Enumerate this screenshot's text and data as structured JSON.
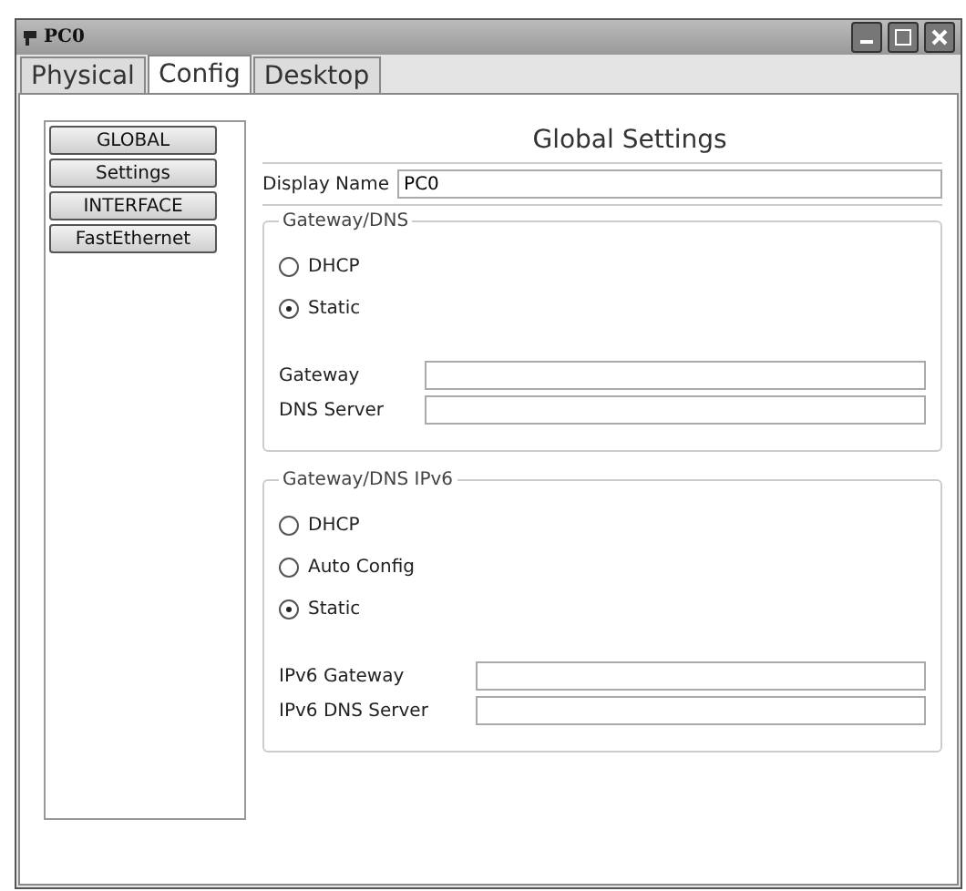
{
  "window": {
    "title": "PC0"
  },
  "tabs": [
    {
      "label": "Physical",
      "selected": false
    },
    {
      "label": "Config",
      "selected": true
    },
    {
      "label": "Desktop",
      "selected": false
    }
  ],
  "sidebar": {
    "items": [
      "GLOBAL",
      "Settings",
      "INTERFACE",
      "FastEthernet"
    ]
  },
  "panel": {
    "title": "Global Settings",
    "display_name": {
      "label": "Display Name",
      "value": "PC0"
    },
    "groups": [
      {
        "title": "Gateway/DNS",
        "options": [
          {
            "label": "DHCP",
            "selected": false
          },
          {
            "label": "Static",
            "selected": true
          }
        ],
        "fields": [
          {
            "label": "Gateway"
          },
          {
            "label": "DNS Server"
          }
        ]
      },
      {
        "title": "Gateway/DNS IPv6",
        "options": [
          {
            "label": "DHCP",
            "selected": false
          },
          {
            "label": "Auto Config",
            "selected": false
          },
          {
            "label": "Static",
            "selected": true
          }
        ],
        "fields": [
          {
            "label": "IPv6 Gateway"
          },
          {
            "label": "IPv6 DNS Server"
          }
        ]
      }
    ]
  }
}
